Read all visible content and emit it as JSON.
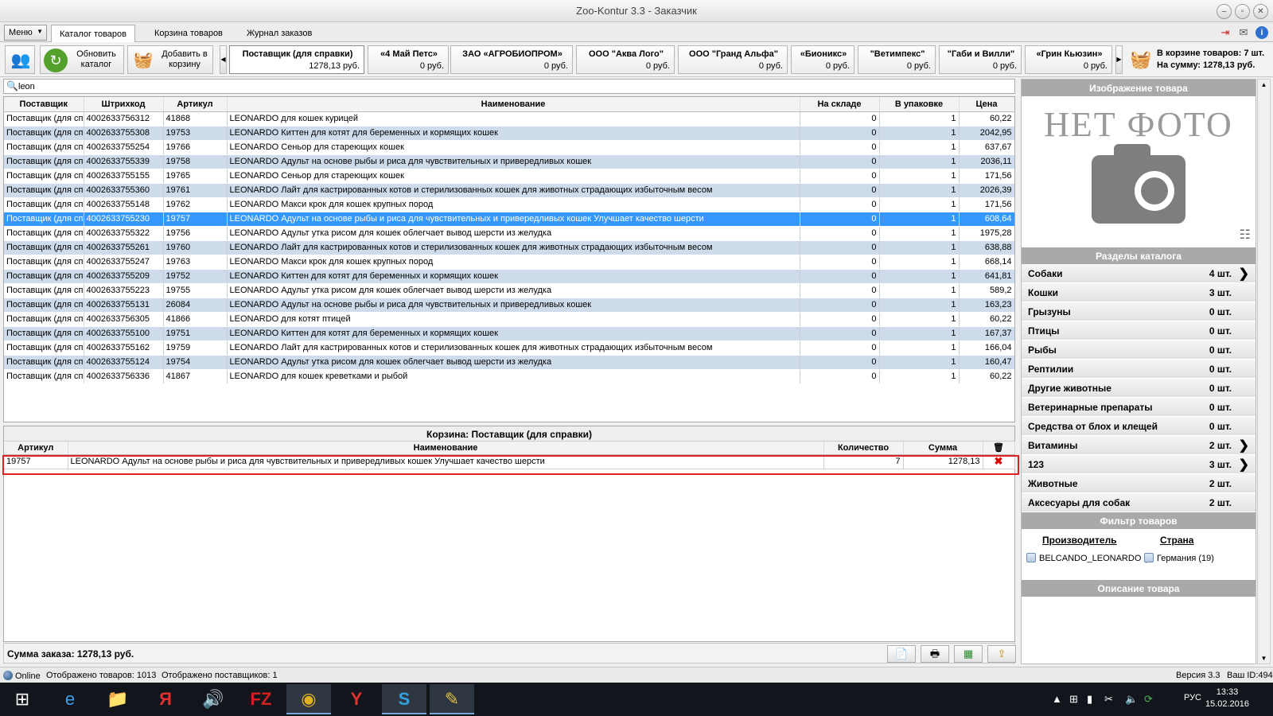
{
  "window": {
    "title": "Zoo-Kontur 3.3 - Заказчик"
  },
  "menu": {
    "label": "Меню"
  },
  "tabs": [
    {
      "label": "Каталог товаров"
    },
    {
      "label": "Корзина товаров"
    },
    {
      "label": "Журнал заказов"
    }
  ],
  "toolbar": {
    "refresh_label": "Обновить каталог",
    "add_label": "Добавить в корзину"
  },
  "suppliers": [
    {
      "name": "Поставщик (для справки)",
      "sum": "1278,13 руб."
    },
    {
      "name": "«4 Май Петс»",
      "sum": "0 руб."
    },
    {
      "name": "ЗАО «АГРОБИОПРОМ»",
      "sum": "0 руб."
    },
    {
      "name": "ООО \"Аква Лого\"",
      "sum": "0 руб."
    },
    {
      "name": "ООО \"Гранд Альфа\"",
      "sum": "0 руб."
    },
    {
      "name": "«Бионикс»",
      "sum": "0 руб."
    },
    {
      "name": "\"Ветимпекс\"",
      "sum": "0 руб."
    },
    {
      "name": "\"Габи и Вилли\"",
      "sum": "0 руб."
    },
    {
      "name": "«Грин Кьюзин»",
      "sum": "0 руб."
    }
  ],
  "cart_info": {
    "line1": "В корзине товаров: 7 шт.",
    "line2": "На сумму: 1278,13 руб."
  },
  "search": {
    "value": "leon"
  },
  "product_table": {
    "columns": [
      "Поставщик",
      "Штрихкод",
      "Артикул",
      "Наименование",
      "На складе",
      "В упаковке",
      "Цена"
    ],
    "rows": [
      [
        "Поставщик (для сп",
        "4002633756312",
        "41868",
        "LEONARDO для кошек курицей",
        "0",
        "1",
        "60,22"
      ],
      [
        "Поставщик (для сп",
        "4002633755308",
        "19753",
        "LEONARDO Киттен для котят для беременных и кормящих кошек",
        "0",
        "1",
        "2042,95"
      ],
      [
        "Поставщик (для сп",
        "4002633755254",
        "19766",
        "LEONARDO Сеньор для стареющих кошек",
        "0",
        "1",
        "637,67"
      ],
      [
        "Поставщик (для сп",
        "4002633755339",
        "19758",
        "LEONARDO Адульт на основе рыбы и риса для чувствительных и привередливых кошек",
        "0",
        "1",
        "2036,11"
      ],
      [
        "Поставщик (для сп",
        "4002633755155",
        "19765",
        "LEONARDO Сеньор для стареющих кошек",
        "0",
        "1",
        "171,56"
      ],
      [
        "Поставщик (для сп",
        "4002633755360",
        "19761",
        "LEONARDO Лайт для кастрированных котов и стерилизованных кошек для животных страдающих избыточным весом",
        "0",
        "1",
        "2026,39"
      ],
      [
        "Поставщик (для сп",
        "4002633755148",
        "19762",
        "LEONARDO Макси крок для кошек крупных пород",
        "0",
        "1",
        "171,56"
      ],
      [
        "Поставщик (для сп",
        "4002633755230",
        "19757",
        "LEONARDO Адульт на основе рыбы и риса для чувствительных и привередливых кошек Улучшает качество шерсти",
        "0",
        "1",
        "608,64"
      ],
      [
        "Поставщик (для сп",
        "4002633755322",
        "19756",
        "LEONARDO Адульт утка рисом для кошек облегчает вывод шерсти из желудка",
        "0",
        "1",
        "1975,28"
      ],
      [
        "Поставщик (для сп",
        "4002633755261",
        "19760",
        "LEONARDO Лайт для кастрированных котов и стерилизованных кошек для животных страдающих избыточным весом",
        "0",
        "1",
        "638,88"
      ],
      [
        "Поставщик (для сп",
        "4002633755247",
        "19763",
        "LEONARDO Макси крок для кошек крупных пород",
        "0",
        "1",
        "668,14"
      ],
      [
        "Поставщик (для сп",
        "4002633755209",
        "19752",
        "LEONARDO Киттен для котят для беременных и кормящих кошек",
        "0",
        "1",
        "641,81"
      ],
      [
        "Поставщик (для сп",
        "4002633755223",
        "19755",
        "LEONARDO Адульт утка рисом для кошек облегчает вывод шерсти из желудка",
        "0",
        "1",
        "589,2"
      ],
      [
        "Поставщик (для сп",
        "4002633755131",
        "26084",
        "LEONARDO Адульт на основе рыбы и риса для чувствительных и привередливых кошек",
        "0",
        "1",
        "163,23"
      ],
      [
        "Поставщик (для сп",
        "4002633756305",
        "41866",
        "LEONARDO для котят птицей",
        "0",
        "1",
        "60,22"
      ],
      [
        "Поставщик (для сп",
        "4002633755100",
        "19751",
        "LEONARDO Киттен для котят для беременных и кормящих кошек",
        "0",
        "1",
        "167,37"
      ],
      [
        "Поставщик (для сп",
        "4002633755162",
        "19759",
        "LEONARDO Лайт для кастрированных котов и стерилизованных кошек для животных страдающих избыточным весом",
        "0",
        "1",
        "166,04"
      ],
      [
        "Поставщик (для сп",
        "4002633755124",
        "19754",
        "LEONARDO Адульт утка рисом для кошек облегчает вывод шерсти из желудка",
        "0",
        "1",
        "160,47"
      ],
      [
        "Поставщик (для сп",
        "4002633756336",
        "41867",
        "LEONARDO для кошек креветками и рыбой",
        "0",
        "1",
        "60,22"
      ]
    ],
    "selected_index": 7
  },
  "cart": {
    "title": "Корзина: Поставщик (для справки)",
    "columns": [
      "Артикул",
      "Наименование",
      "Количество",
      "Сумма"
    ],
    "rows": [
      [
        "19757",
        "LEONARDO Адульт на основе рыбы и риса для чувствительных и привередливых кошек Улучшает качество шерсти",
        "7",
        "1278,13"
      ]
    ],
    "total": "Сумма заказа: 1278,13 руб."
  },
  "status": {
    "online": "Online",
    "products_shown": "Отображено товаров: 1013",
    "suppliers_shown": "Отображено поставщиков: 1",
    "version": "Версия 3.3",
    "user_id": "Ваш ID:494"
  },
  "right_panel": {
    "image_title": "Изображение товара",
    "no_photo": "НЕТ ФОТО",
    "sections_title": "Разделы каталога",
    "categories": [
      {
        "name": "Собаки",
        "count": "4 шт.",
        "expandable": true
      },
      {
        "name": "Кошки",
        "count": "3 шт.",
        "expandable": false
      },
      {
        "name": "Грызуны",
        "count": "0 шт.",
        "expandable": false
      },
      {
        "name": "Птицы",
        "count": "0 шт.",
        "expandable": false
      },
      {
        "name": "Рыбы",
        "count": "0 шт.",
        "expandable": false
      },
      {
        "name": "Рептилии",
        "count": "0 шт.",
        "expandable": false
      },
      {
        "name": "Другие животные",
        "count": "0 шт.",
        "expandable": false
      },
      {
        "name": "Ветеринарные препараты",
        "count": "0 шт.",
        "expandable": false
      },
      {
        "name": "Средства от блох и клещей",
        "count": "0 шт.",
        "expandable": false
      },
      {
        "name": "Витамины",
        "count": "2 шт.",
        "expandable": true
      },
      {
        "name": "123",
        "count": "3 шт.",
        "expandable": true
      },
      {
        "name": "Животные",
        "count": "2 шт.",
        "expandable": false
      },
      {
        "name": "Аксесуары для собак",
        "count": "2 шт.",
        "expandable": false
      }
    ],
    "filter_title": "Фильтр товаров",
    "filter": {
      "manufacturer_header": "Производитель",
      "country_header": "Страна",
      "manufacturer_value": "BELCANDO_LEONARDO (",
      "country_value": "Германия (19)"
    },
    "description_title": "Описание товара"
  },
  "taskbar": {
    "language": "РУС",
    "time": "13:33",
    "date": "15.02.2016"
  }
}
